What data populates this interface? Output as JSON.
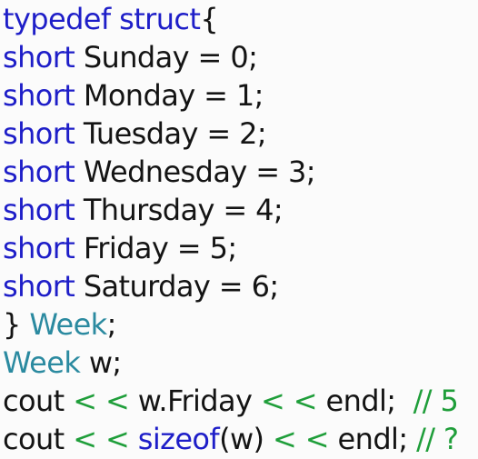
{
  "colors": {
    "keyword": "#1e1ec8",
    "type_name": "#2b8aa0",
    "operator": "#1f9e3a",
    "comment": "#1f9e3a",
    "text": "#141414",
    "background": "#fbfbfb"
  },
  "code_lines": [
    [
      {
        "t": "typedef struct",
        "c": "kw"
      },
      {
        "t": "{",
        "c": "punct"
      }
    ],
    [
      {
        "t": "short",
        "c": "kw"
      },
      {
        "t": " Sunday = 0;",
        "c": "id"
      }
    ],
    [
      {
        "t": "short",
        "c": "kw"
      },
      {
        "t": " Monday = 1;",
        "c": "id"
      }
    ],
    [
      {
        "t": "short",
        "c": "kw"
      },
      {
        "t": " Tuesday = 2;",
        "c": "id"
      }
    ],
    [
      {
        "t": "short",
        "c": "kw"
      },
      {
        "t": " Wednesday = 3;",
        "c": "id"
      }
    ],
    [
      {
        "t": "short",
        "c": "kw"
      },
      {
        "t": " Thursday = 4;",
        "c": "id"
      }
    ],
    [
      {
        "t": "short",
        "c": "kw"
      },
      {
        "t": " Friday = 5;",
        "c": "id"
      }
    ],
    [
      {
        "t": "short",
        "c": "kw"
      },
      {
        "t": " Saturday = 6;",
        "c": "id"
      }
    ],
    [
      {
        "t": "} ",
        "c": "punct"
      },
      {
        "t": "Week",
        "c": "type"
      },
      {
        "t": ";",
        "c": "punct"
      }
    ],
    [
      {
        "t": "Week",
        "c": "type"
      },
      {
        "t": " w;",
        "c": "id"
      }
    ],
    [
      {
        "t": "cout ",
        "c": "id"
      },
      {
        "t": "< <",
        "c": "op"
      },
      {
        "t": " w.Friday ",
        "c": "id"
      },
      {
        "t": "< <",
        "c": "op"
      },
      {
        "t": " endl;  ",
        "c": "id"
      },
      {
        "t": "// 5",
        "c": "cmt"
      }
    ],
    [
      {
        "t": "cout ",
        "c": "id"
      },
      {
        "t": "< <",
        "c": "op"
      },
      {
        "t": " ",
        "c": "id"
      },
      {
        "t": "sizeof",
        "c": "fn"
      },
      {
        "t": "(w) ",
        "c": "id"
      },
      {
        "t": "< <",
        "c": "op"
      },
      {
        "t": " endl; ",
        "c": "id"
      },
      {
        "t": "// ?",
        "c": "cmt"
      }
    ]
  ]
}
